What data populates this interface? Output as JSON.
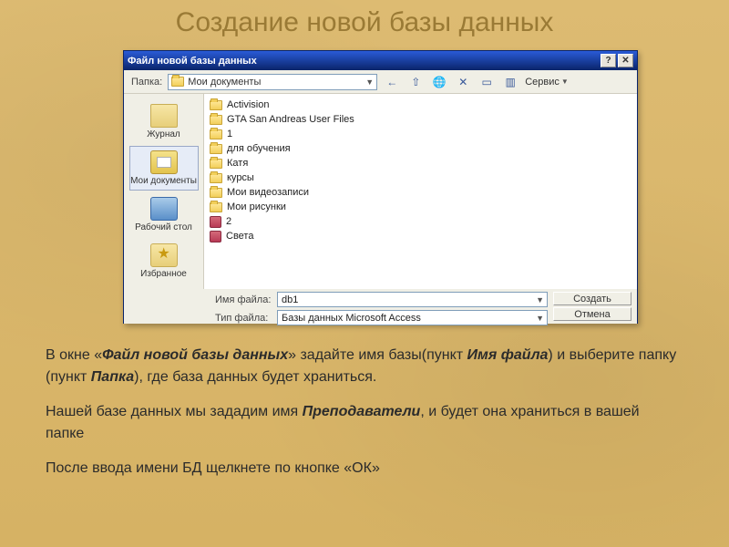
{
  "slide": {
    "title": "Создание новой базы данных",
    "para1_a": "В окне «",
    "para1_bold1": "Файл новой базы данных",
    "para1_b": "» задайте имя базы(пункт ",
    "para1_bold2": "Имя файла",
    "para1_c": ") и выберите папку (пункт ",
    "para1_bold3": "Папка",
    "para1_d": "), где база данных будет храниться.",
    "para2_a": "Нашей базе данных мы зададим имя ",
    "para2_bold": "Преподаватели",
    "para2_b": ", и будет она храниться в вашей папке",
    "para3": "После ввода имени БД щелкнете по кнопке «ОК»"
  },
  "dialog": {
    "title": "Файл новой базы данных",
    "folder_label": "Папка:",
    "current_folder": "Мои документы",
    "service_label": "Сервис",
    "places": [
      "Журнал",
      "Мои документы",
      "Рабочий стол",
      "Избранное"
    ],
    "files": [
      {
        "t": "folder",
        "n": "Activision"
      },
      {
        "t": "folder",
        "n": "GTA San Andreas User Files"
      },
      {
        "t": "folder",
        "n": "1"
      },
      {
        "t": "folder",
        "n": "для обучения"
      },
      {
        "t": "folder",
        "n": "Катя"
      },
      {
        "t": "folder",
        "n": "курсы"
      },
      {
        "t": "folder",
        "n": "Мои видеозаписи"
      },
      {
        "t": "folder",
        "n": "Мои рисунки"
      },
      {
        "t": "access",
        "n": "2"
      },
      {
        "t": "access",
        "n": "Света"
      }
    ],
    "filename_label": "Имя файла:",
    "filename_value": "db1",
    "filetype_label": "Тип файла:",
    "filetype_value": "Базы данных Microsoft Access",
    "btn_create": "Создать",
    "btn_cancel": "Отмена"
  }
}
